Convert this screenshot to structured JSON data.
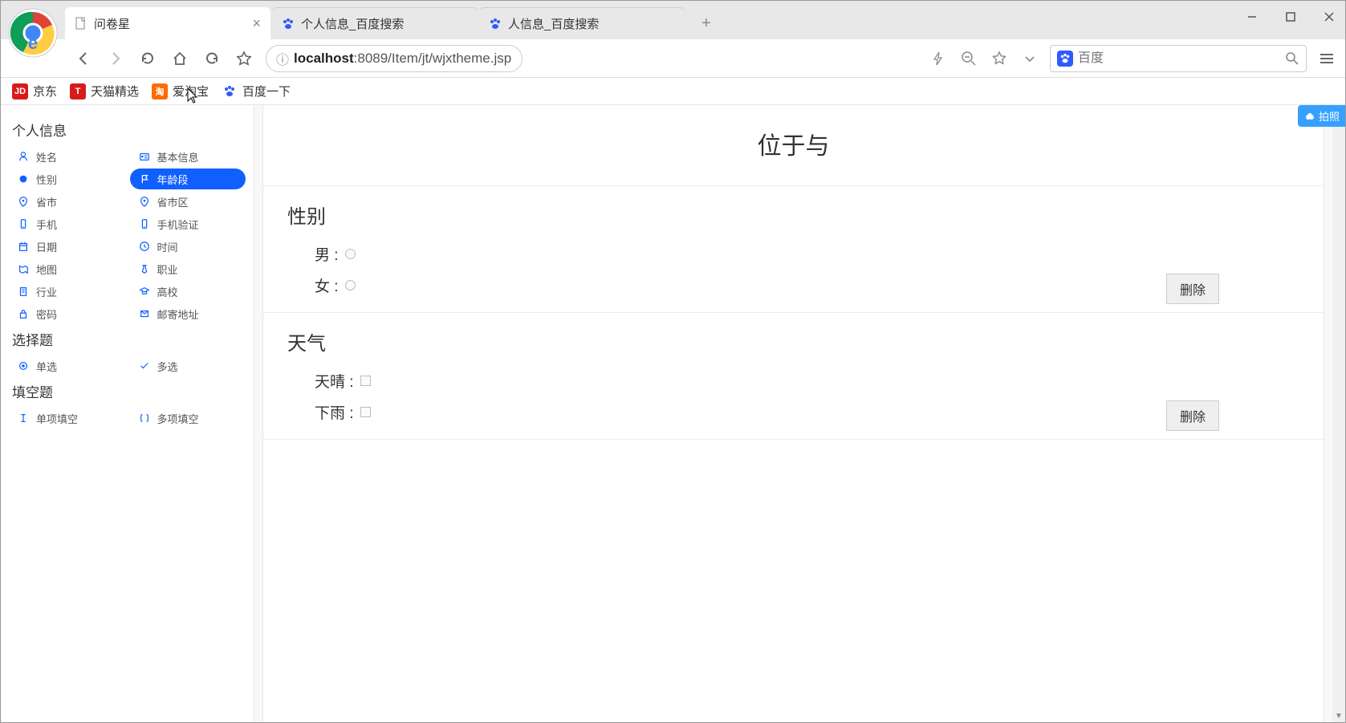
{
  "tabs": [
    {
      "title": "问卷星",
      "active": true
    },
    {
      "title": "个人信息_百度搜索",
      "active": false
    },
    {
      "title": "人信息_百度搜索",
      "active": false
    }
  ],
  "address": {
    "host": "localhost",
    "rest": ":8089/Item/jt/wjxtheme.jsp"
  },
  "search": {
    "placeholder": "百度"
  },
  "bookmarks": [
    {
      "label": "京东",
      "badge": "JD",
      "color": "#d71b1b"
    },
    {
      "label": "天猫精选",
      "badge": "T",
      "color": "#d71b1b"
    },
    {
      "label": "爱淘宝",
      "badge": "淘",
      "color": "#ff6a00"
    },
    {
      "label": "百度一下",
      "badge": "",
      "color": "#2e5bff"
    }
  ],
  "sidebar": {
    "sections": [
      {
        "title": "个人信息",
        "items": [
          {
            "label": "姓名",
            "icon": "user"
          },
          {
            "label": "基本信息",
            "icon": "card"
          },
          {
            "label": "性别",
            "icon": "gender"
          },
          {
            "label": "年龄段",
            "icon": "flag",
            "active": true
          },
          {
            "label": "省市",
            "icon": "pin"
          },
          {
            "label": "省市区",
            "icon": "pin"
          },
          {
            "label": "手机",
            "icon": "phone"
          },
          {
            "label": "手机验证",
            "icon": "phone"
          },
          {
            "label": "日期",
            "icon": "calendar"
          },
          {
            "label": "时间",
            "icon": "clock"
          },
          {
            "label": "地图",
            "icon": "map"
          },
          {
            "label": "职业",
            "icon": "tie"
          },
          {
            "label": "行业",
            "icon": "building"
          },
          {
            "label": "高校",
            "icon": "grad"
          },
          {
            "label": "密码",
            "icon": "lock"
          },
          {
            "label": "邮寄地址",
            "icon": "mail"
          }
        ]
      },
      {
        "title": "选择题",
        "items": [
          {
            "label": "单选",
            "icon": "radio"
          },
          {
            "label": "多选",
            "icon": "check"
          }
        ]
      },
      {
        "title": "填空题",
        "items": [
          {
            "label": "单项填空",
            "icon": "textcursor"
          },
          {
            "label": "多项填空",
            "icon": "brackets"
          }
        ]
      }
    ]
  },
  "form": {
    "title": "位于与",
    "questions": [
      {
        "title": "性别",
        "type": "radio",
        "options": [
          "男",
          "女"
        ],
        "delete_label": "删除"
      },
      {
        "title": "天气",
        "type": "checkbox",
        "options": [
          "天晴",
          "下雨"
        ],
        "delete_label": "删除"
      }
    ]
  },
  "float_badge": "拍照"
}
